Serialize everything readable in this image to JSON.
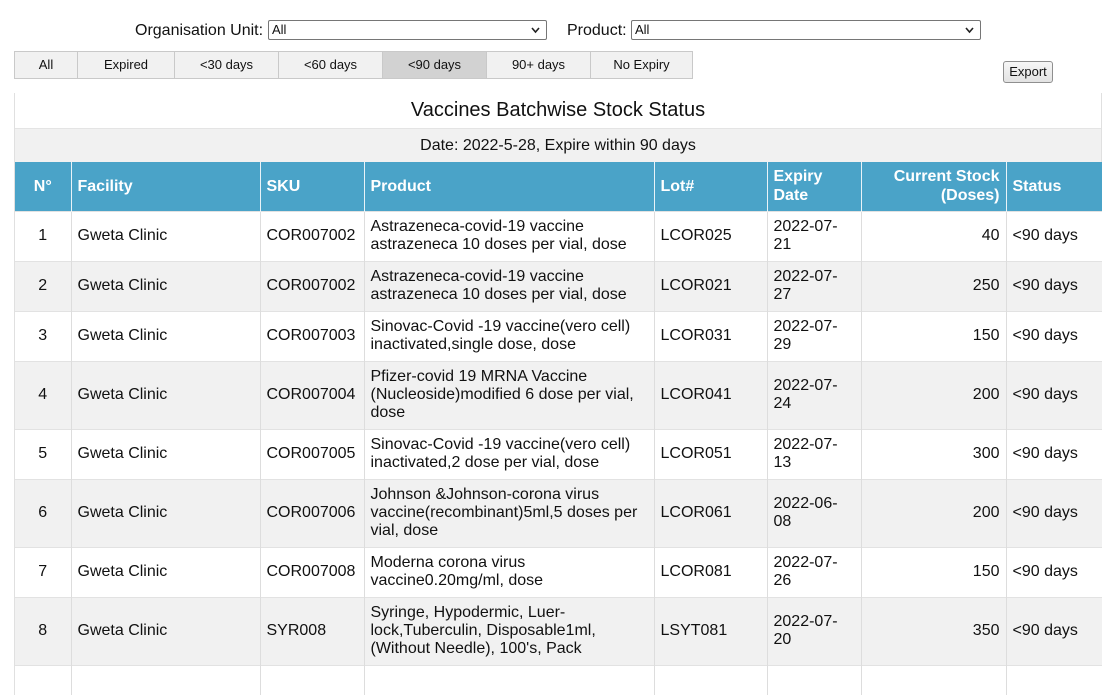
{
  "filters": {
    "org_unit_label": "Organisation Unit:",
    "org_unit_value": "All",
    "product_label": "Product:",
    "product_value": "All"
  },
  "tabs": [
    {
      "label": "All",
      "active": false
    },
    {
      "label": "Expired",
      "active": false
    },
    {
      "label": "<30 days",
      "active": false
    },
    {
      "label": "<60 days",
      "active": false
    },
    {
      "label": "<90 days",
      "active": true
    },
    {
      "label": "90+ days",
      "active": false
    },
    {
      "label": "No Expiry",
      "active": false
    }
  ],
  "export_label": "Export",
  "report": {
    "title": "Vaccines Batchwise Stock Status",
    "date_line": "Date: 2022-5-28, Expire within 90 days",
    "columns": [
      "N°",
      "Facility",
      "SKU",
      "Product",
      "Lot#",
      "Expiry Date",
      "Current Stock (Doses)",
      "Status"
    ],
    "rows": [
      {
        "n": "1",
        "facility": "Gweta Clinic",
        "sku": "COR007002",
        "product": "Astrazeneca-covid-19 vaccine astrazeneca 10 doses per vial, dose",
        "lot": "LCOR025",
        "expiry": "2022-07-21",
        "stock": "40",
        "status": "<90 days"
      },
      {
        "n": "2",
        "facility": "Gweta Clinic",
        "sku": "COR007002",
        "product": "Astrazeneca-covid-19 vaccine astrazeneca 10 doses per vial, dose",
        "lot": "LCOR021",
        "expiry": "2022-07-27",
        "stock": "250",
        "status": "<90 days"
      },
      {
        "n": "3",
        "facility": "Gweta Clinic",
        "sku": "COR007003",
        "product": "Sinovac-Covid -19 vaccine(vero cell) inactivated,single dose, dose",
        "lot": "LCOR031",
        "expiry": "2022-07-29",
        "stock": "150",
        "status": "<90 days"
      },
      {
        "n": "4",
        "facility": "Gweta Clinic",
        "sku": "COR007004",
        "product": "Pfizer-covid 19 MRNA Vaccine (Nucleoside)modified 6 dose per vial, dose",
        "lot": "LCOR041",
        "expiry": "2022-07-24",
        "stock": "200",
        "status": "<90 days"
      },
      {
        "n": "5",
        "facility": "Gweta Clinic",
        "sku": "COR007005",
        "product": "Sinovac-Covid -19 vaccine(vero cell) inactivated,2 dose per vial, dose",
        "lot": "LCOR051",
        "expiry": "2022-07-13",
        "stock": "300",
        "status": "<90 days"
      },
      {
        "n": "6",
        "facility": "Gweta Clinic",
        "sku": "COR007006",
        "product": "Johnson &Johnson-corona virus vaccine(recombinant)5ml,5 doses per vial, dose",
        "lot": "LCOR061",
        "expiry": "2022-06-08",
        "stock": "200",
        "status": "<90 days"
      },
      {
        "n": "7",
        "facility": "Gweta Clinic",
        "sku": "COR007008",
        "product": "Moderna corona virus vaccine0.20mg/ml, dose",
        "lot": "LCOR081",
        "expiry": "2022-07-26",
        "stock": "150",
        "status": "<90 days"
      },
      {
        "n": "8",
        "facility": "Gweta Clinic",
        "sku": "SYR008",
        "product": "Syringe, Hypodermic, Luer-lock,Tuberculin, Disposable1ml, (Without Needle), 100's, Pack",
        "lot": "LSYT081",
        "expiry": "2022-07-20",
        "stock": "350",
        "status": "<90 days"
      }
    ]
  }
}
